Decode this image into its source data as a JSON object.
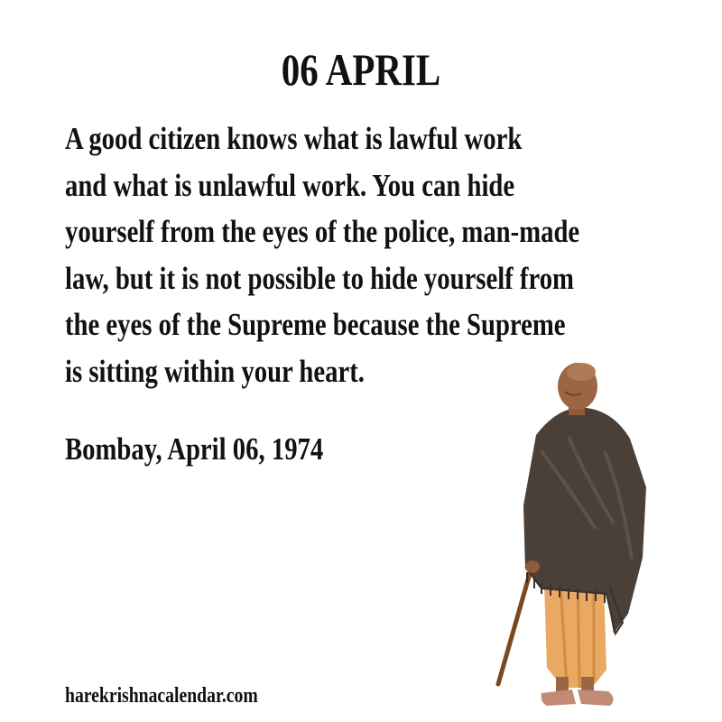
{
  "header": {
    "date": "06 APRIL"
  },
  "quote": {
    "lines": [
      "A good citizen knows what is lawful work",
      "and what is unlawful work. You can hide",
      "yourself from the eyes of the police, man-made",
      "law, but it is not possible to hide yourself from",
      "the eyes of the Supreme because the Supreme",
      "is sitting within your heart."
    ],
    "source": "Bombay, April 06, 1974"
  },
  "footer": {
    "website": "harekrishnacalendar.com"
  },
  "figure": {
    "icon": "standing-monk-with-cane"
  }
}
